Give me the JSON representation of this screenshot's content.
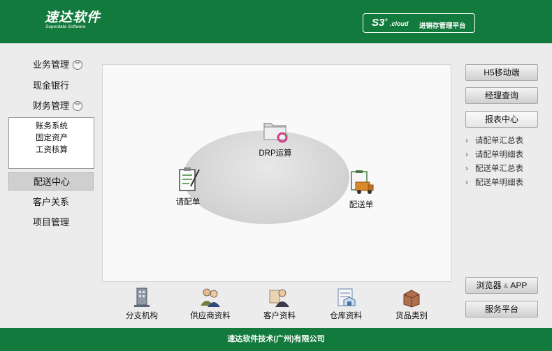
{
  "header": {
    "logo_main": "速达软件",
    "logo_sub": "Superdata Software",
    "platform_s3": "S3",
    "platform_plus": "+",
    "platform_cloud": ".cloud",
    "platform_name": "进销存管理平台",
    "bg_color": "#127a3c"
  },
  "left_nav": {
    "items": [
      {
        "label": "业务管理",
        "expandable": true
      },
      {
        "label": "现金银行",
        "expandable": false
      },
      {
        "label": "财务管理",
        "expandable": true
      },
      {
        "label": "配送中心",
        "active": true
      },
      {
        "label": "客户关系"
      },
      {
        "label": "项目管理"
      }
    ],
    "finance_sub": [
      "账务系统",
      "固定资产",
      "工资核算"
    ]
  },
  "diagram": {
    "nodes": [
      {
        "label": "DRP运算",
        "icon": "drp-folder-icon"
      },
      {
        "label": "请配单",
        "icon": "clipboard-pen-icon"
      },
      {
        "label": "配送单",
        "icon": "delivery-truck-icon"
      }
    ]
  },
  "bottom_bar": [
    {
      "label": "分支机构",
      "icon": "branch-building-icon"
    },
    {
      "label": "供应商资料",
      "icon": "supplier-people-icon"
    },
    {
      "label": "客户资料",
      "icon": "customer-person-icon"
    },
    {
      "label": "仓库资料",
      "icon": "warehouse-icon"
    },
    {
      "label": "货品类别",
      "icon": "goods-box-icon"
    }
  ],
  "right_panel": {
    "buttons_top": [
      "H5移动端",
      "经理查询"
    ],
    "report_center_label": "报表中心",
    "reports": [
      "请配单汇总表",
      "请配单明细表",
      "配送单汇总表",
      "配送单明细表"
    ],
    "buttons_bottom": {
      "browser_app": "浏览器",
      "amp": "&",
      "app": "APP",
      "service": "服务平台"
    }
  },
  "footer": {
    "company": "速达软件技术(广州)有限公司"
  }
}
